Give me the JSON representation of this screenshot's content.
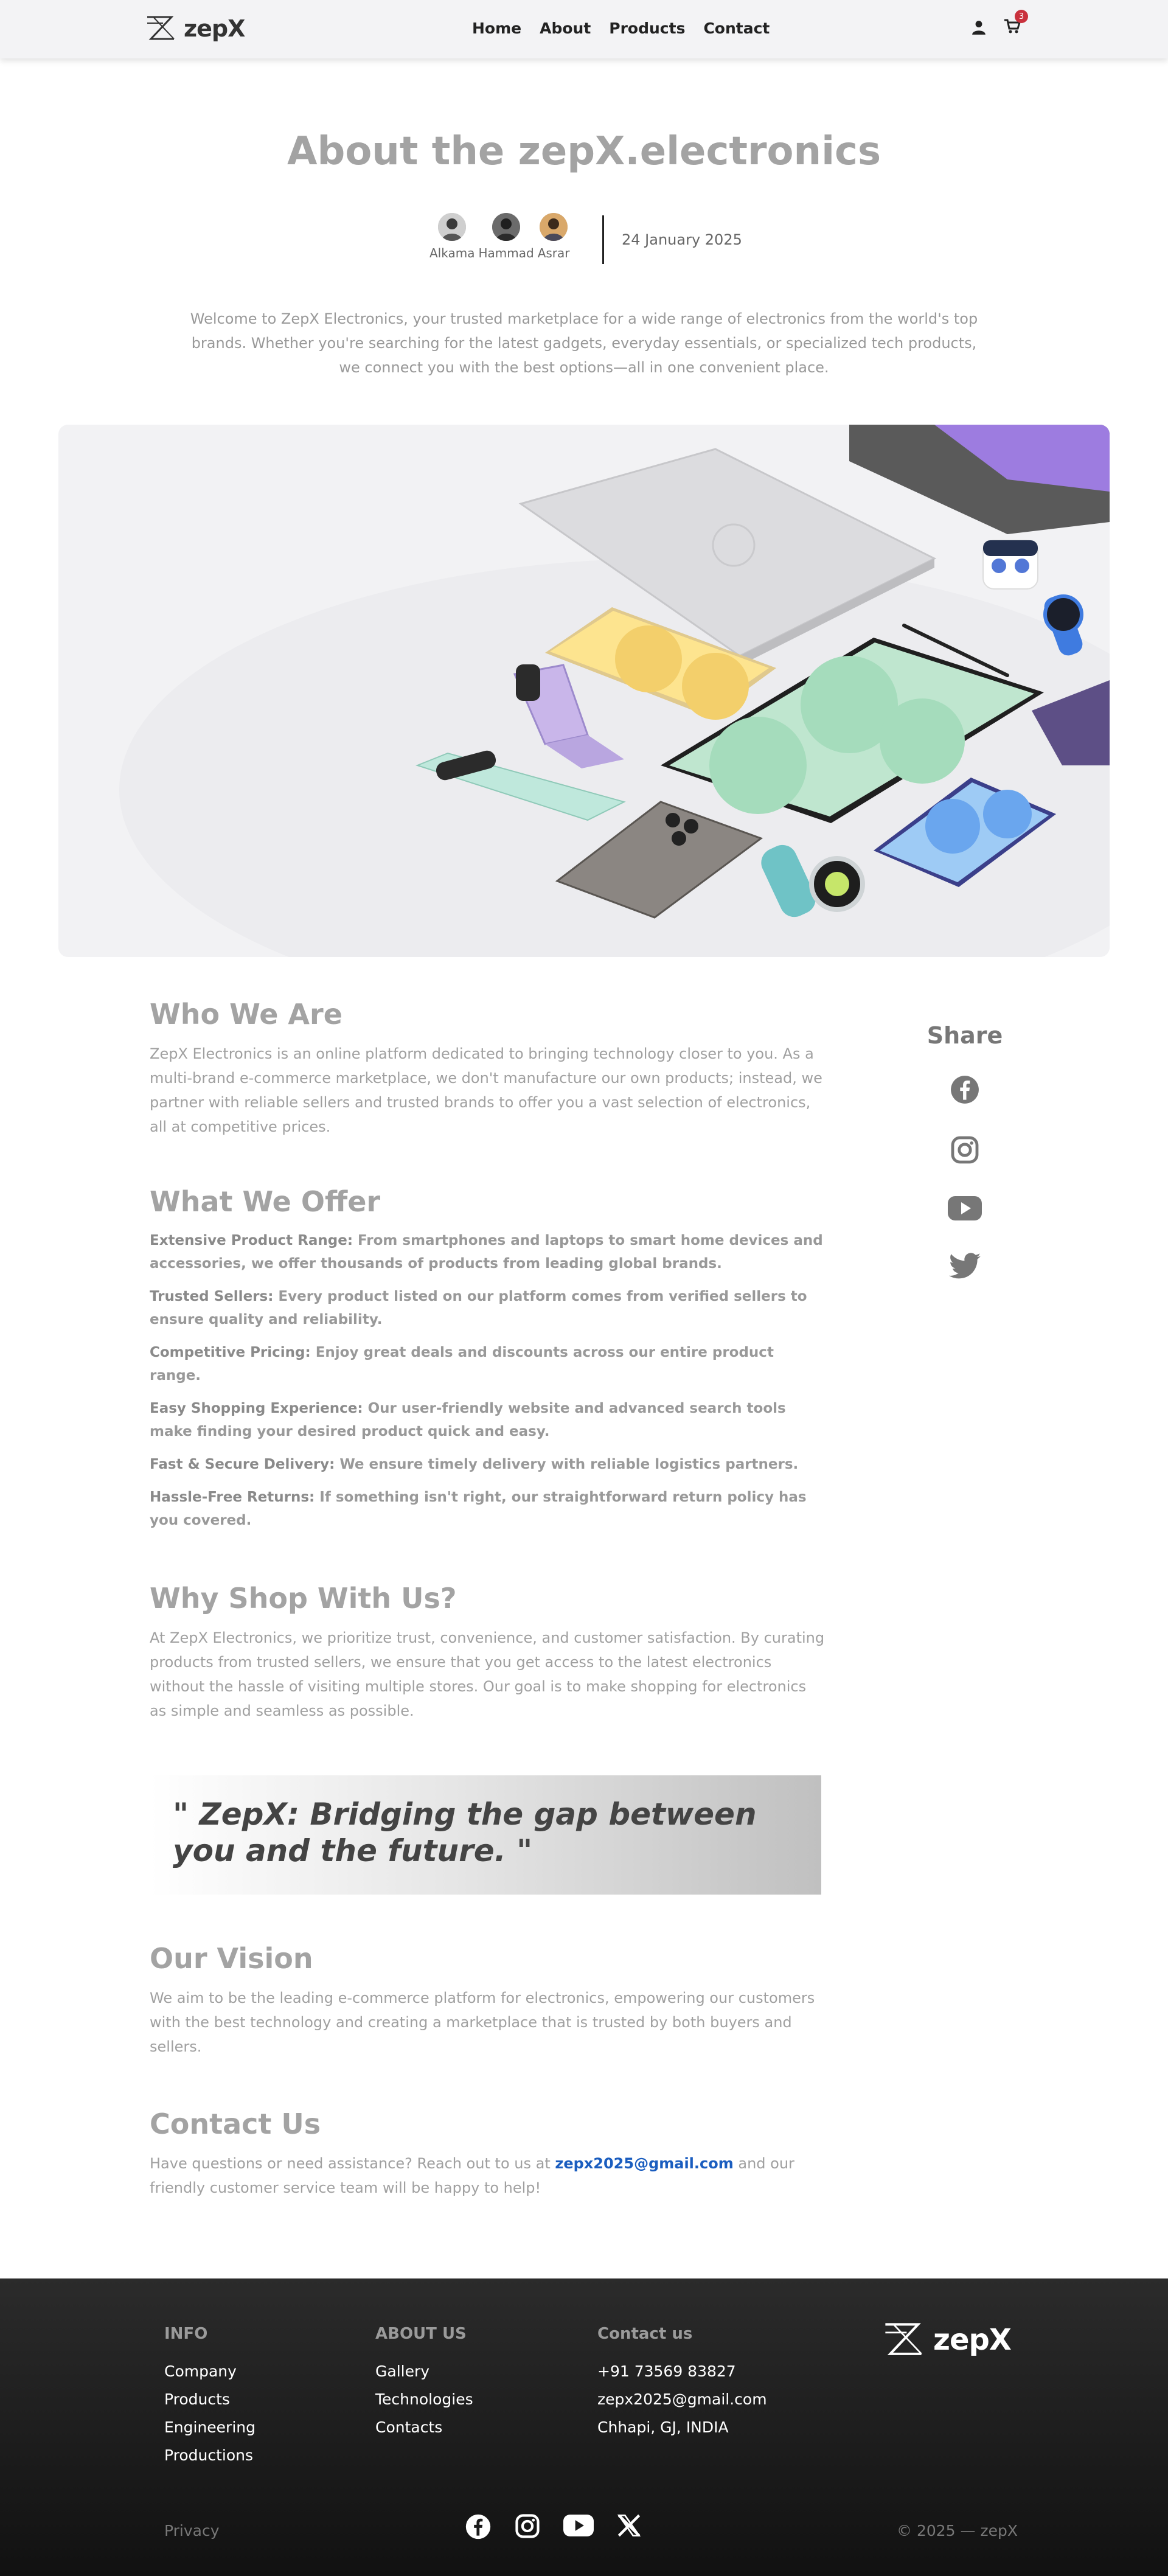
{
  "brand": {
    "name": "zepX"
  },
  "nav": {
    "links": [
      "Home",
      "About",
      "Products",
      "Contact"
    ],
    "cart_count": "3"
  },
  "header": {
    "title": "About the zepX.electronics",
    "authors": [
      "Alkama",
      "Hammad",
      "Asrar"
    ],
    "date": "24 January 2025",
    "intro": "Welcome to ZepX Electronics, your trusted marketplace for a wide range of electronics from the world's top brands. Whether you're searching for the latest gadgets, everyday essentials, or specialized tech products, we connect you with the best options—all in one convenient place."
  },
  "who": {
    "title": "Who We Are",
    "text": "ZepX Electronics is an online platform dedicated to bringing technology closer to you. As a multi-brand e-commerce marketplace, we don't manufacture our own products; instead, we partner with reliable sellers and trusted brands to offer you a vast selection of electronics, all at competitive prices."
  },
  "offer": {
    "title": "What We Offer",
    "items": [
      {
        "label": "Extensive Product Range:",
        "text": " From smartphones and laptops to smart home devices and accessories, we offer thousands of products from leading global brands."
      },
      {
        "label": "Trusted Sellers:",
        "text": " Every product listed on our platform comes from verified sellers to ensure quality and reliability."
      },
      {
        "label": "Competitive Pricing:",
        "text": " Enjoy great deals and discounts across our entire product range."
      },
      {
        "label": "Easy Shopping Experience:",
        "text": " Our user-friendly website and advanced search tools make finding your desired product quick and easy."
      },
      {
        "label": "Fast & Secure Delivery:",
        "text": " We ensure timely delivery with reliable logistics partners."
      },
      {
        "label": "Hassle-Free Returns:",
        "text": " If something isn't right, our straightforward return policy has you covered."
      }
    ]
  },
  "why": {
    "title": "Why Shop With Us?",
    "text": "At ZepX Electronics, we prioritize trust, convenience, and customer satisfaction. By curating products from trusted sellers, we ensure that you get access to the latest electronics without the hassle of visiting multiple stores. Our goal is to make shopping for electronics as simple and seamless as possible."
  },
  "quote": "\" ZepX: Bridging the gap between you and the future. \"",
  "vision": {
    "title": "Our Vision",
    "text": "We aim to be the leading e-commerce platform for electronics, empowering our customers with the best technology and creating a marketplace that is trusted by both buyers and sellers."
  },
  "contact": {
    "title": "Contact Us",
    "before": "Have questions or need assistance? Reach out to us at ",
    "email": "zepx2025@gmail.com",
    "after": " and our friendly customer service team will be happy to help!"
  },
  "share": {
    "title": "Share",
    "icons": [
      "facebook-icon",
      "instagram-icon",
      "youtube-icon",
      "twitter-icon"
    ]
  },
  "footer": {
    "info": {
      "title": "INFO",
      "items": [
        "Company",
        "Products",
        "Engineering",
        "Productions"
      ]
    },
    "about": {
      "title": "ABOUT US",
      "items": [
        "Gallery",
        "Technologies",
        "Contacts"
      ]
    },
    "contact": {
      "title": "Contact us",
      "items": [
        "+91 73569 83827",
        "zepx2025@gmail.com",
        "Chhapi, GJ, INDIA"
      ]
    },
    "privacy": "Privacy",
    "copyright": "© 2025 — zepX",
    "social_icons": [
      "facebook-icon",
      "instagram-icon",
      "youtube-icon",
      "x-icon"
    ]
  },
  "colors": {
    "accent_link": "#1a5dbf",
    "badge": "#c9313d",
    "footer_bg": "#1a1a1a"
  }
}
